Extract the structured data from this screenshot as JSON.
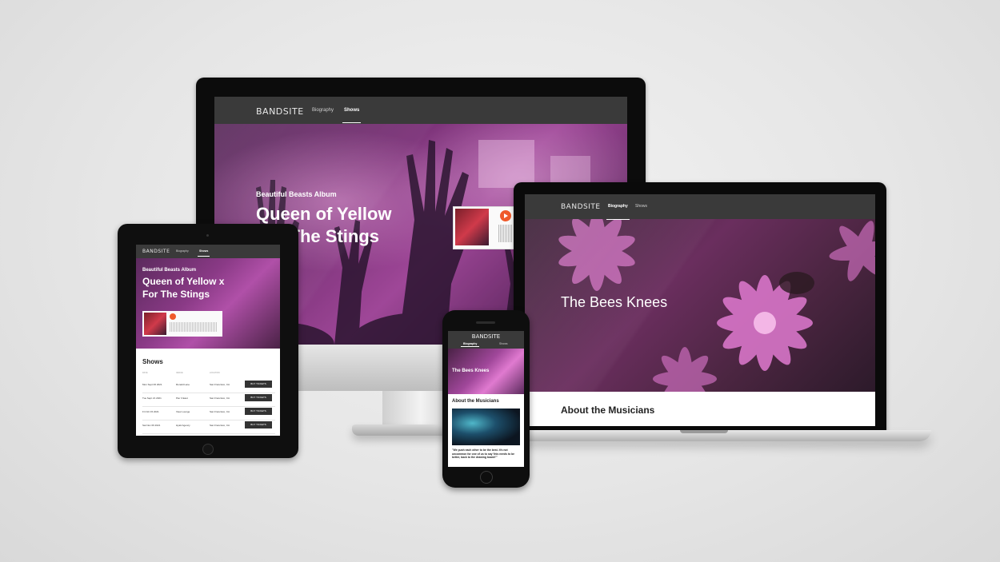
{
  "site": {
    "brand": "BANDSITE",
    "nav": [
      "Biography",
      "Shows"
    ]
  },
  "imac": {
    "album_label": "Beautiful Beasts Album",
    "title_line1": "Queen of Yellow",
    "title_line2": "For The Stings"
  },
  "ipad": {
    "album_label": "Beautiful Beasts Album",
    "title_line1": "Queen of Yellow x",
    "title_line2": "For The Stings",
    "shows_heading": "Shows",
    "columns": [
      "DATE",
      "VENUE",
      "LOCATION"
    ],
    "shows": [
      {
        "date": "Mon Sept 06 2021",
        "venue": "Ronald Lane",
        "location": "San Francisco, CA",
        "button": "BUY TICKETS"
      },
      {
        "date": "Tue Sept 21 2021",
        "venue": "Pier 3 East",
        "location": "San Francisco, CA",
        "button": "BUY TICKETS"
      },
      {
        "date": "Fri Oct 15 2021",
        "venue": "View Lounge",
        "location": "San Francisco, CA",
        "button": "BUY TICKETS"
      },
      {
        "date": "Sat Nov 06 2021",
        "venue": "Hyatt Agency",
        "location": "San Francisco, CA",
        "button": "BUY TICKETS"
      }
    ]
  },
  "laptop": {
    "hero_title": "The Bees Knees",
    "section_title": "About the Musicians"
  },
  "phone": {
    "hero_title": "The Bees Knees",
    "section_title": "About the Musicians",
    "quote": "\"We push each other to be the best. It's not uncommon for one of us to say 'this needs to be better, back to the drawing board!'\""
  },
  "colors": {
    "nav_bg": "#3a3a3a",
    "accent_orange": "#ef5a2b",
    "hero_magenta": "#b050a8"
  }
}
